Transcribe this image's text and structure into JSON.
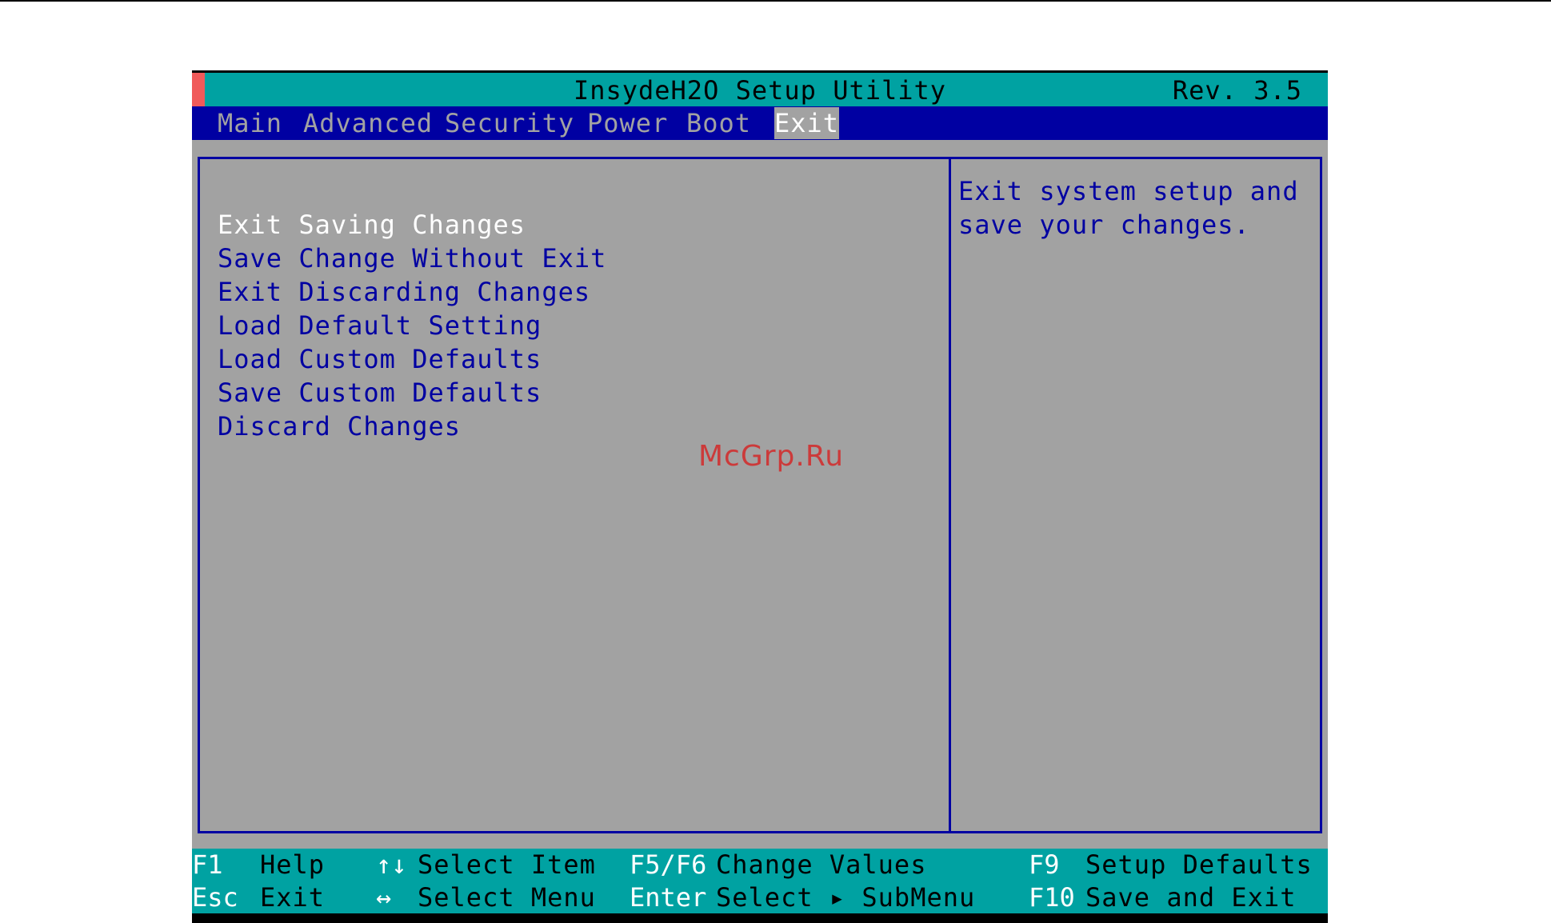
{
  "title": "InsydeH2O Setup Utility",
  "revision": "Rev. 3.5",
  "menu": [
    "Main",
    "Advanced",
    "Security",
    "Power",
    "Boot",
    "Exit"
  ],
  "active_menu": "Exit",
  "options": [
    "Exit Saving Changes",
    "Save Change Without Exit",
    "Exit Discarding Changes",
    "Load Default Setting",
    "Load Custom Defaults",
    "Save Custom Defaults",
    "Discard Changes"
  ],
  "selected_option": "Exit Saving Changes",
  "help_lines": [
    "Exit system setup and",
    "save your changes."
  ],
  "watermark": "McGrp.Ru",
  "footer": {
    "row1": [
      {
        "key": "F1",
        "desc": "Help"
      },
      {
        "key": "↑↓",
        "desc": "Select Item"
      },
      {
        "key": "F5/F6",
        "desc": "Change Values"
      },
      {
        "key": "F9",
        "desc": "Setup Defaults"
      }
    ],
    "row2": [
      {
        "key": "Esc",
        "desc": "Exit"
      },
      {
        "key": "↔",
        "desc": "Select Menu"
      },
      {
        "key": "Enter",
        "desc": "Select ▸ SubMenu"
      },
      {
        "key": "F10",
        "desc": "Save and Exit"
      }
    ]
  },
  "colors": {
    "teal": "#00a2a2",
    "blue": "#0000a2",
    "gray": "#a2a2a2",
    "accent": "#f05a5a"
  }
}
